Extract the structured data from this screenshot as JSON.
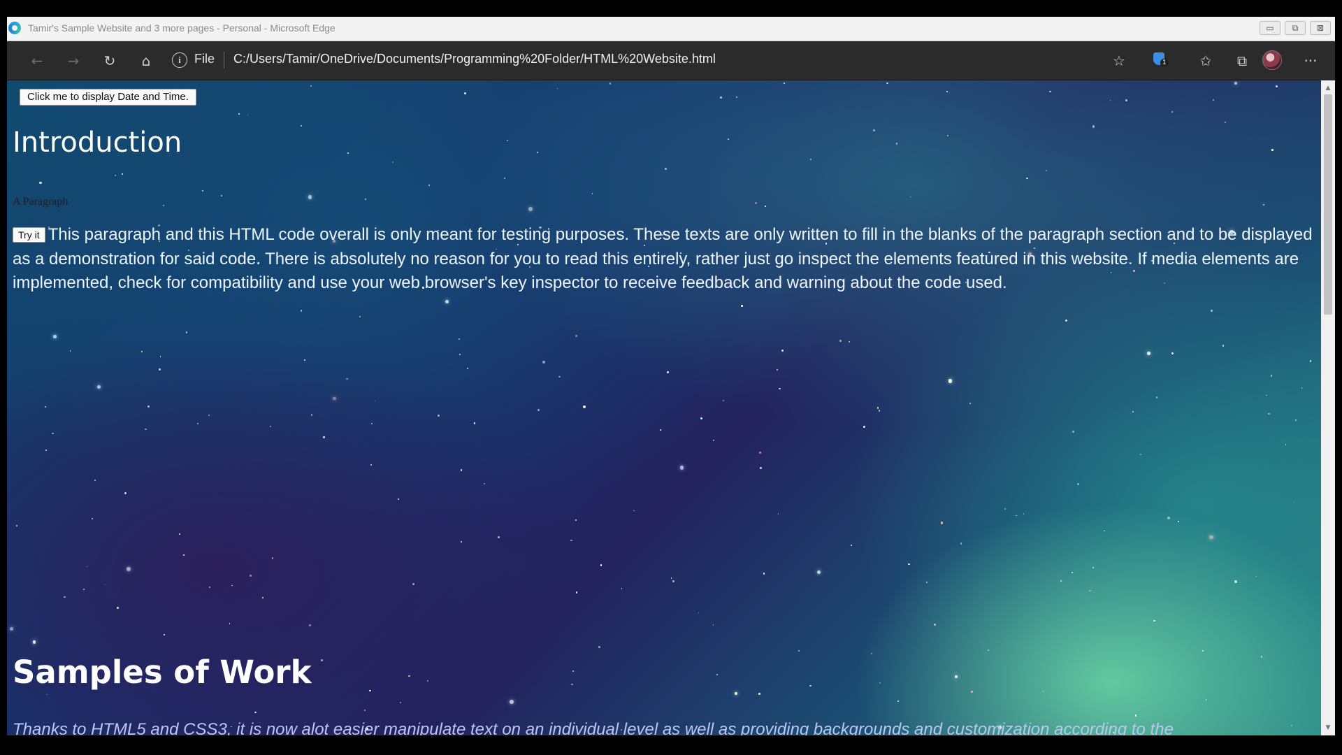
{
  "window": {
    "title": "Tamir's Sample Website and 3 more pages - Personal - Microsoft Edge",
    "controls": {
      "minimize": "▭",
      "restore": "⧉",
      "close": "⊠"
    }
  },
  "toolbar": {
    "back_icon": "←",
    "forward_icon": "→",
    "refresh_icon": "↻",
    "home_icon": "⌂",
    "site_info": "i",
    "file_label": "File",
    "url": "C:/Users/Tamir/OneDrive/Documents/Programming%20Folder/HTML%20Website.html",
    "favorite_icon": "☆",
    "extension_badge_count": "1",
    "favorites_icon": "✩",
    "collections_icon": "⧉",
    "menu_icon": "···"
  },
  "page": {
    "datetime_button": "Click me to display Date and Time.",
    "intro_heading": "Introduction",
    "small_paragraph": "A Paragraph",
    "try_button": "Try it",
    "paragraph": "This paragraph and this HTML code overall is only meant for testing purposes. These texts are only written to fill in the blanks of the paragraph section and to be displayed as a demonstration for said code. There is absolutely no reason for you to read this entirely, rather just go inspect the elements featured in this website. If media elements are implemented, check for compatibility and use your web browser's key inspector to receive feedback and warning about the code used.",
    "samples_heading": "Samples of Work",
    "samples_text": "Thanks to HTML5 and CSS3, it is now alot easier manipulate text on an individual level as well as providing backgrounds and customization according to the"
  },
  "scrollbar": {
    "up_icon": "▲",
    "down_icon": "▼",
    "scroll_position": 0.0
  },
  "colors": {
    "heading": "#ffffff",
    "paragraph": "#eef4ff",
    "samples_text": "#b9c7f0",
    "nebula_green": "#78e6aa",
    "space_navy": "#23225e"
  }
}
